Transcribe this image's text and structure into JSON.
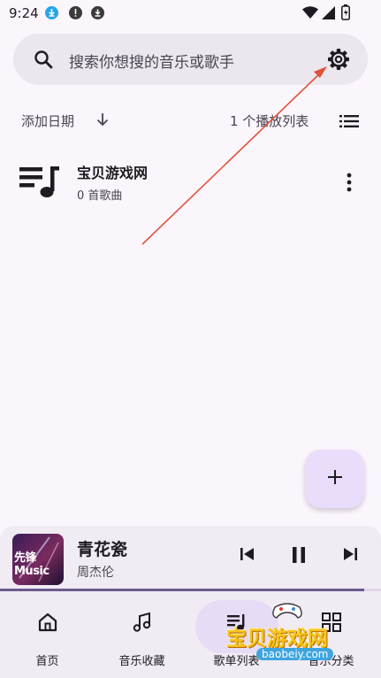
{
  "status_bar": {
    "time": "9:24"
  },
  "search": {
    "placeholder": "搜索你想搜的音乐或歌手"
  },
  "sort": {
    "label": "添加日期",
    "count": "1 个播放列表"
  },
  "playlists": [
    {
      "title": "宝贝游戏网",
      "subtitle": "0 首歌曲"
    }
  ],
  "now_playing": {
    "song": "青花瓷",
    "artist": "周杰伦",
    "cover_text": "先锋Music",
    "progress": 0.955
  },
  "nav": {
    "items": [
      {
        "label": "首页"
      },
      {
        "label": "音乐收藏"
      },
      {
        "label": "歌单列表",
        "selected": true
      },
      {
        "label": "音乐分类"
      }
    ]
  },
  "watermark": {
    "text": "宝贝游戏网",
    "url": "baobeiy.com"
  },
  "colors": {
    "accent": "#6a5a8c",
    "annotation_arrow": "#e0533a",
    "fab": "#eaddfb"
  }
}
